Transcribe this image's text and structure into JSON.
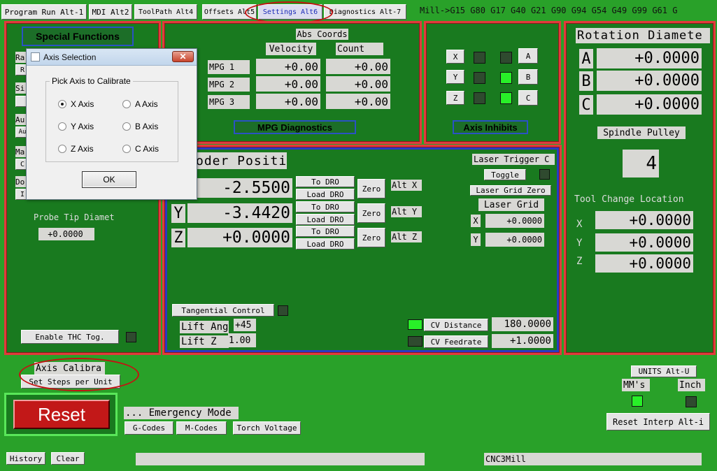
{
  "tabs": [
    "Program Run Alt-1",
    "MDI Alt2",
    "ToolPath Alt4",
    "Offsets Alt5",
    "Settings Alt6",
    "Diagnostics Alt-7"
  ],
  "status_line": "Mill->G15  G80 G17 G40 G21 G90 G94 G54 G49 G99 G61 G",
  "special_functions": {
    "title": "Special Functions",
    "probe_label": "Probe Tip Diamet",
    "probe_value": "+0.0000",
    "thc_button": "Enable THC Tog.",
    "left_fragments": [
      "Ra",
      "R",
      "Si",
      "Au",
      "Au",
      "Ma",
      "C",
      "Do",
      "I"
    ]
  },
  "mpg": {
    "header": "Abs Coords",
    "col_velocity": "Velocity",
    "col_count": "Count",
    "rows": [
      {
        "label": "MPG 1",
        "velocity": "+0.00",
        "count": "+0.00"
      },
      {
        "label": "MPG 2",
        "velocity": "+0.00",
        "count": "+0.00"
      },
      {
        "label": "MPG 3",
        "velocity": "+0.00",
        "count": "+0.00"
      }
    ],
    "diag_button": "MPG Diagnostics"
  },
  "axis_inhibits": {
    "left": [
      "X",
      "Y",
      "Z"
    ],
    "right": [
      "A",
      "B",
      "C"
    ],
    "button": "Axis Inhibits",
    "leds": [
      "off",
      "off",
      "off",
      "on",
      "off",
      "on"
    ]
  },
  "rotation": {
    "title": "Rotation Diamete",
    "axes": [
      {
        "axis": "A",
        "value": "+0.0000"
      },
      {
        "axis": "B",
        "value": "+0.0000"
      },
      {
        "axis": "C",
        "value": "+0.0000"
      }
    ],
    "spindle_label": "Spindle Pulley",
    "spindle_value": "4",
    "tool_change_label": "Tool Change Location",
    "tool_change": [
      {
        "axis": "X",
        "value": "+0.0000"
      },
      {
        "axis": "Y",
        "value": "+0.0000"
      },
      {
        "axis": "Z",
        "value": "+0.0000"
      }
    ]
  },
  "encoder": {
    "title": "oder Positi",
    "rows": [
      {
        "axis": "X",
        "value": "-2.5500",
        "to_dro": "To DRO",
        "load_dro": "Load DRO",
        "zero": "Zero",
        "alt": "Alt X"
      },
      {
        "axis": "Y",
        "value": "-3.4420",
        "to_dro": "To DRO",
        "load_dro": "Load DRO",
        "zero": "Zero",
        "alt": "Alt Y"
      },
      {
        "axis": "Z",
        "value": "+0.0000",
        "to_dro": "To DRO",
        "load_dro": "Load DRO",
        "zero": "Zero",
        "alt": "Alt Z"
      }
    ],
    "laser_trigger": "Laser Trigger C",
    "toggle": "Toggle",
    "laser_grid_zero": "Laser Grid Zero",
    "laser_grid": "Laser Grid",
    "laser_x_label": "X",
    "laser_x": "+0.0000",
    "laser_y_label": "Y",
    "laser_y": "+0.0000",
    "tangential": "Tangential Control",
    "lift_angle_label": "Lift Ang",
    "lift_angle": "+45",
    "lift_z_label": "Lift Z",
    "lift_z": "1.00",
    "cv_distance": "CV Distance",
    "cv_distance_value": "180.0000",
    "cv_feedrate": "CV Feedrate",
    "cv_feedrate_value": "+1.0000"
  },
  "bottom": {
    "axis_calib": "Axis Calibra",
    "set_steps": "Set Steps per Unit",
    "reset": "Reset",
    "emergency": "... Emergency Mode",
    "gcodes": "G-Codes",
    "mcodes": "M-Codes",
    "torch": "Torch Voltage",
    "units": "UNITS Alt-U",
    "mms": "MM's",
    "inch": "Inch",
    "reset_interp": "Reset Interp Alt-i",
    "history": "History",
    "clear": "Clear",
    "profile": "CNC3Mill"
  },
  "dialog": {
    "title": "Axis Selection",
    "group": "Pick Axis to Calibrate",
    "options": [
      "X Axis",
      "A Axis",
      "Y Axis",
      "B Axis",
      "Z Axis",
      "C Axis"
    ],
    "selected": "X Axis",
    "ok": "OK"
  }
}
